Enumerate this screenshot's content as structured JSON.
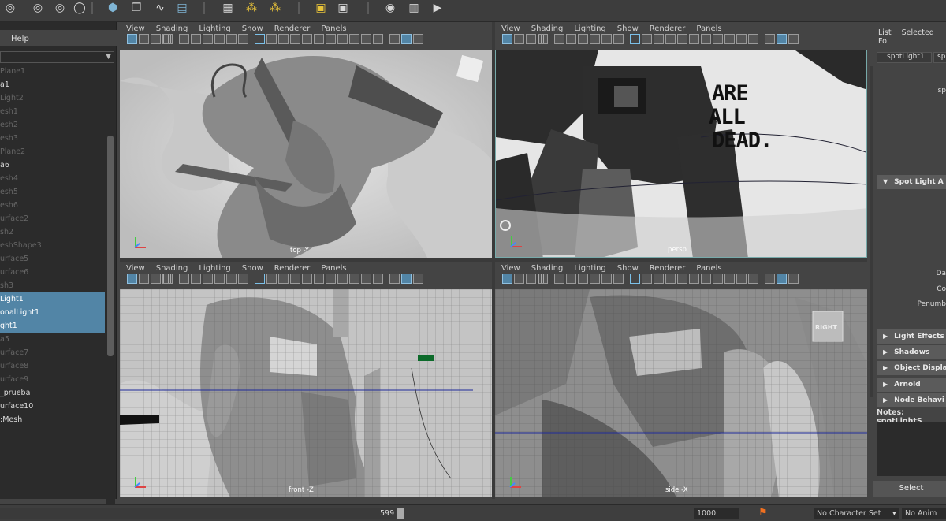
{
  "outliner": {
    "help_label": "Help",
    "items": [
      {
        "label": "Plane1",
        "style": "dim"
      },
      {
        "label": "a1",
        "style": "bright"
      },
      {
        "label": "Light2",
        "style": "dim"
      },
      {
        "label": "esh1",
        "style": "dim"
      },
      {
        "label": "esh2",
        "style": "dim"
      },
      {
        "label": "esh3",
        "style": "dim"
      },
      {
        "label": "Plane2",
        "style": "dim"
      },
      {
        "label": "a6",
        "style": "bright"
      },
      {
        "label": "esh4",
        "style": "dim"
      },
      {
        "label": "esh5",
        "style": "dim"
      },
      {
        "label": "esh6",
        "style": "dim"
      },
      {
        "label": "urface2",
        "style": "dim"
      },
      {
        "label": "sh2",
        "style": "dim"
      },
      {
        "label": "eshShape3",
        "style": "dim"
      },
      {
        "label": "urface5",
        "style": "dim"
      },
      {
        "label": "urface6",
        "style": "dim"
      },
      {
        "label": "sh3",
        "style": "dim"
      },
      {
        "label": "Light1",
        "style": "sel"
      },
      {
        "label": "onalLight1",
        "style": "sel"
      },
      {
        "label": "ght1",
        "style": "sel"
      },
      {
        "label": "a5",
        "style": "dim"
      },
      {
        "label": "urface7",
        "style": "dim"
      },
      {
        "label": "urface8",
        "style": "dim"
      },
      {
        "label": "urface9",
        "style": "dim"
      },
      {
        "label": "_prueba",
        "style": "bright"
      },
      {
        "label": "urface10",
        "style": "bright"
      },
      {
        "label": ":Mesh",
        "style": "bright"
      }
    ]
  },
  "viewport_menu": [
    "View",
    "Shading",
    "Lighting",
    "Show",
    "Renderer",
    "Panels"
  ],
  "viewports": {
    "top": {
      "label": "top -Y"
    },
    "persp": {
      "label": "persp"
    },
    "front": {
      "label": "front -Z"
    },
    "side": {
      "label": "side -X",
      "cube_label": "RIGHT"
    }
  },
  "scene_text": {
    "are": "ARE",
    "all": "ALL",
    "dead": "DEAD."
  },
  "attribute_editor": {
    "menu": [
      "List",
      "Selected",
      "Fo"
    ],
    "tab1": "spotLight1",
    "tab2": "sp",
    "sp_label": "sp",
    "frames": {
      "spot": "Spot Light A",
      "light_effects": "Light Effects",
      "shadows": "Shadows",
      "object_display": "Object Displa",
      "arnold": "Arnold",
      "node_behavior": "Node Behavi"
    },
    "labels": {
      "da": "Da",
      "co": "Co",
      "penumb": "Penumb"
    },
    "notes_label": "Notes:  spotLightS",
    "select_button": "Select"
  },
  "timebar": {
    "current_frame": "599",
    "end_frame": "1000",
    "character_set": "No Character Set",
    "anim_layer": "No Anim Lay"
  },
  "colors": {
    "selection": "#5285a6",
    "panel_bg": "#444444",
    "outliner_bg": "#2b2b2b"
  }
}
